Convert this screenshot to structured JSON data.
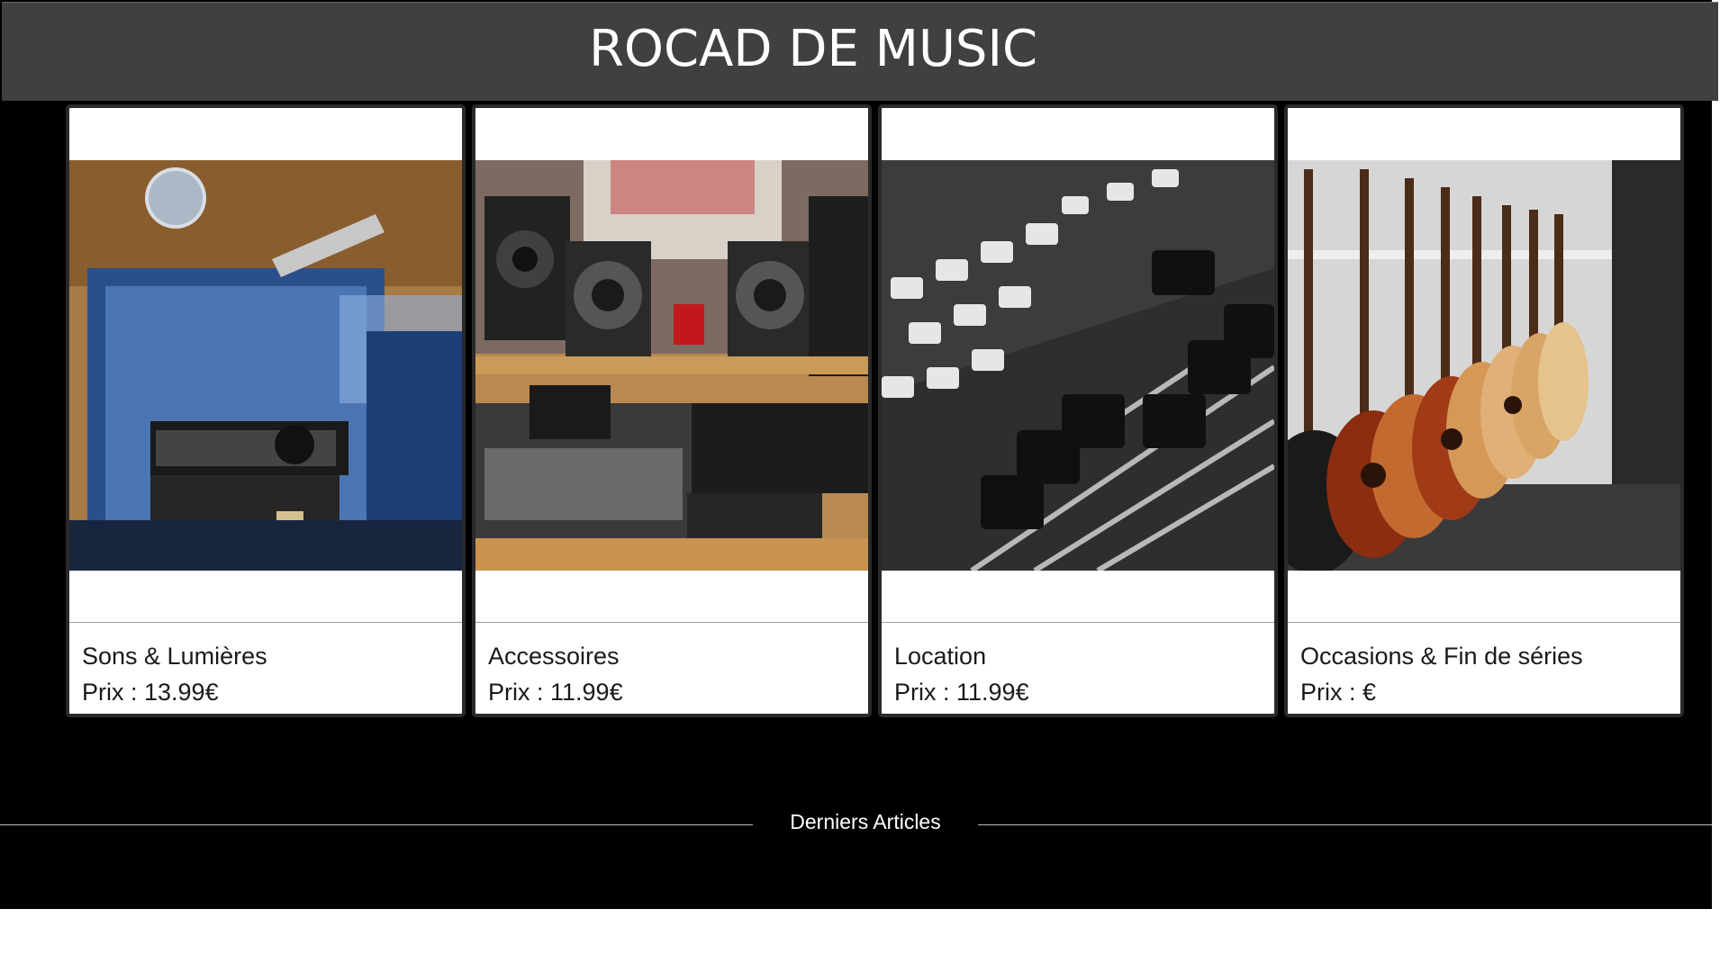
{
  "header": {
    "title": "ROCAD DE MUSIC"
  },
  "products": [
    {
      "name": "Sons & Lumières",
      "price": "Prix : 13.99€",
      "image": "dj-equipment-photo"
    },
    {
      "name": "Accessoires",
      "price": "Prix : 11.99€",
      "image": "studio-monitors-mixers-photo"
    },
    {
      "name": "Location",
      "price": "Prix : 11.99€",
      "image": "mixing-console-faders-photo"
    },
    {
      "name": "Occasions & Fin de séries",
      "price": "Prix : €",
      "image": "guitars-on-rack-photo"
    }
  ],
  "section": {
    "title": "Derniers Articles"
  },
  "colors": {
    "header_bg": "#404040",
    "page_bg": "#000000",
    "card_bg": "#ffffff",
    "text": "#1a1a1a"
  }
}
